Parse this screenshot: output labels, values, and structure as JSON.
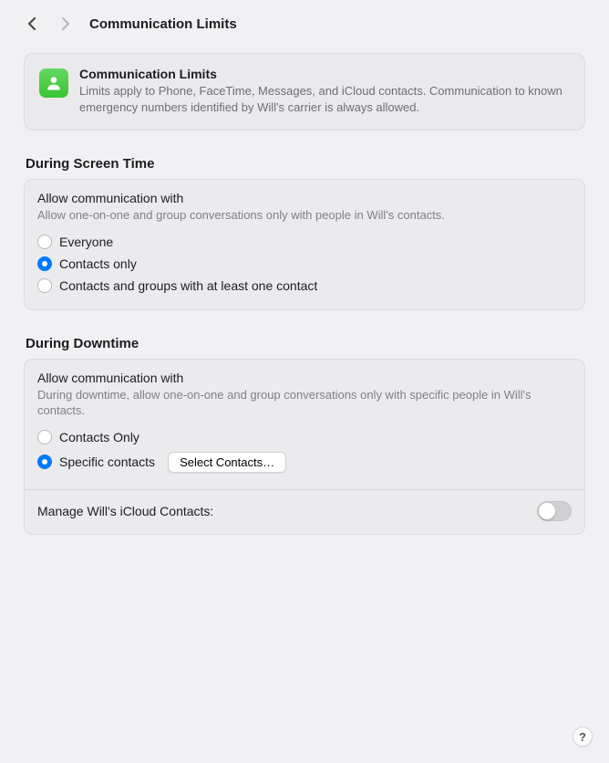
{
  "header": {
    "title": "Communication Limits"
  },
  "infobox": {
    "title": "Communication Limits",
    "description": "Limits apply to Phone, FaceTime, Messages, and iCloud contacts. Communication to known emergency numbers identified by Will's carrier is always allowed."
  },
  "sections": {
    "screentime": {
      "header": "During Screen Time",
      "card_title": "Allow communication with",
      "card_sub": "Allow one-on-one and group conversations only with people in Will's contacts.",
      "options": {
        "everyone": "Everyone",
        "contacts_only": "Contacts only",
        "contacts_groups": "Contacts and groups with at least one contact"
      },
      "selected": "contacts_only"
    },
    "downtime": {
      "header": "During Downtime",
      "card_title": "Allow communication with",
      "card_sub": "During downtime, allow one-on-one and group conversations only with specific people in Will's contacts.",
      "options": {
        "contacts_only": "Contacts Only",
        "specific": "Specific contacts"
      },
      "selected": "specific",
      "select_button": "Select Contacts…",
      "manage_label": "Manage Will's iCloud Contacts:",
      "manage_enabled": false
    }
  },
  "help_label": "?"
}
